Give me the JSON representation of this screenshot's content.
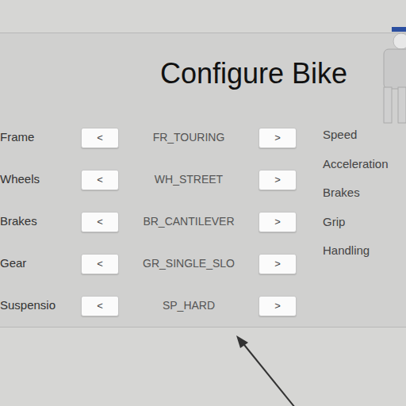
{
  "screen_title": "Configure Bike",
  "options": [
    {
      "label": "Frame",
      "value": "FR_TOURING",
      "prev": "<",
      "next": ">"
    },
    {
      "label": "Wheels",
      "value": "WH_STREET",
      "prev": "<",
      "next": ">"
    },
    {
      "label": "Brakes",
      "value": "BR_CANTILEVER",
      "prev": "<",
      "next": ">"
    },
    {
      "label": "Gear",
      "value": "GR_SINGLE_SLO",
      "prev": "<",
      "next": ">"
    },
    {
      "label": "Suspensio",
      "value": "SP_HARD",
      "prev": "<",
      "next": ">"
    }
  ],
  "stats": [
    "Speed",
    "Acceleration",
    "Brakes",
    "Grip",
    "Handling"
  ]
}
